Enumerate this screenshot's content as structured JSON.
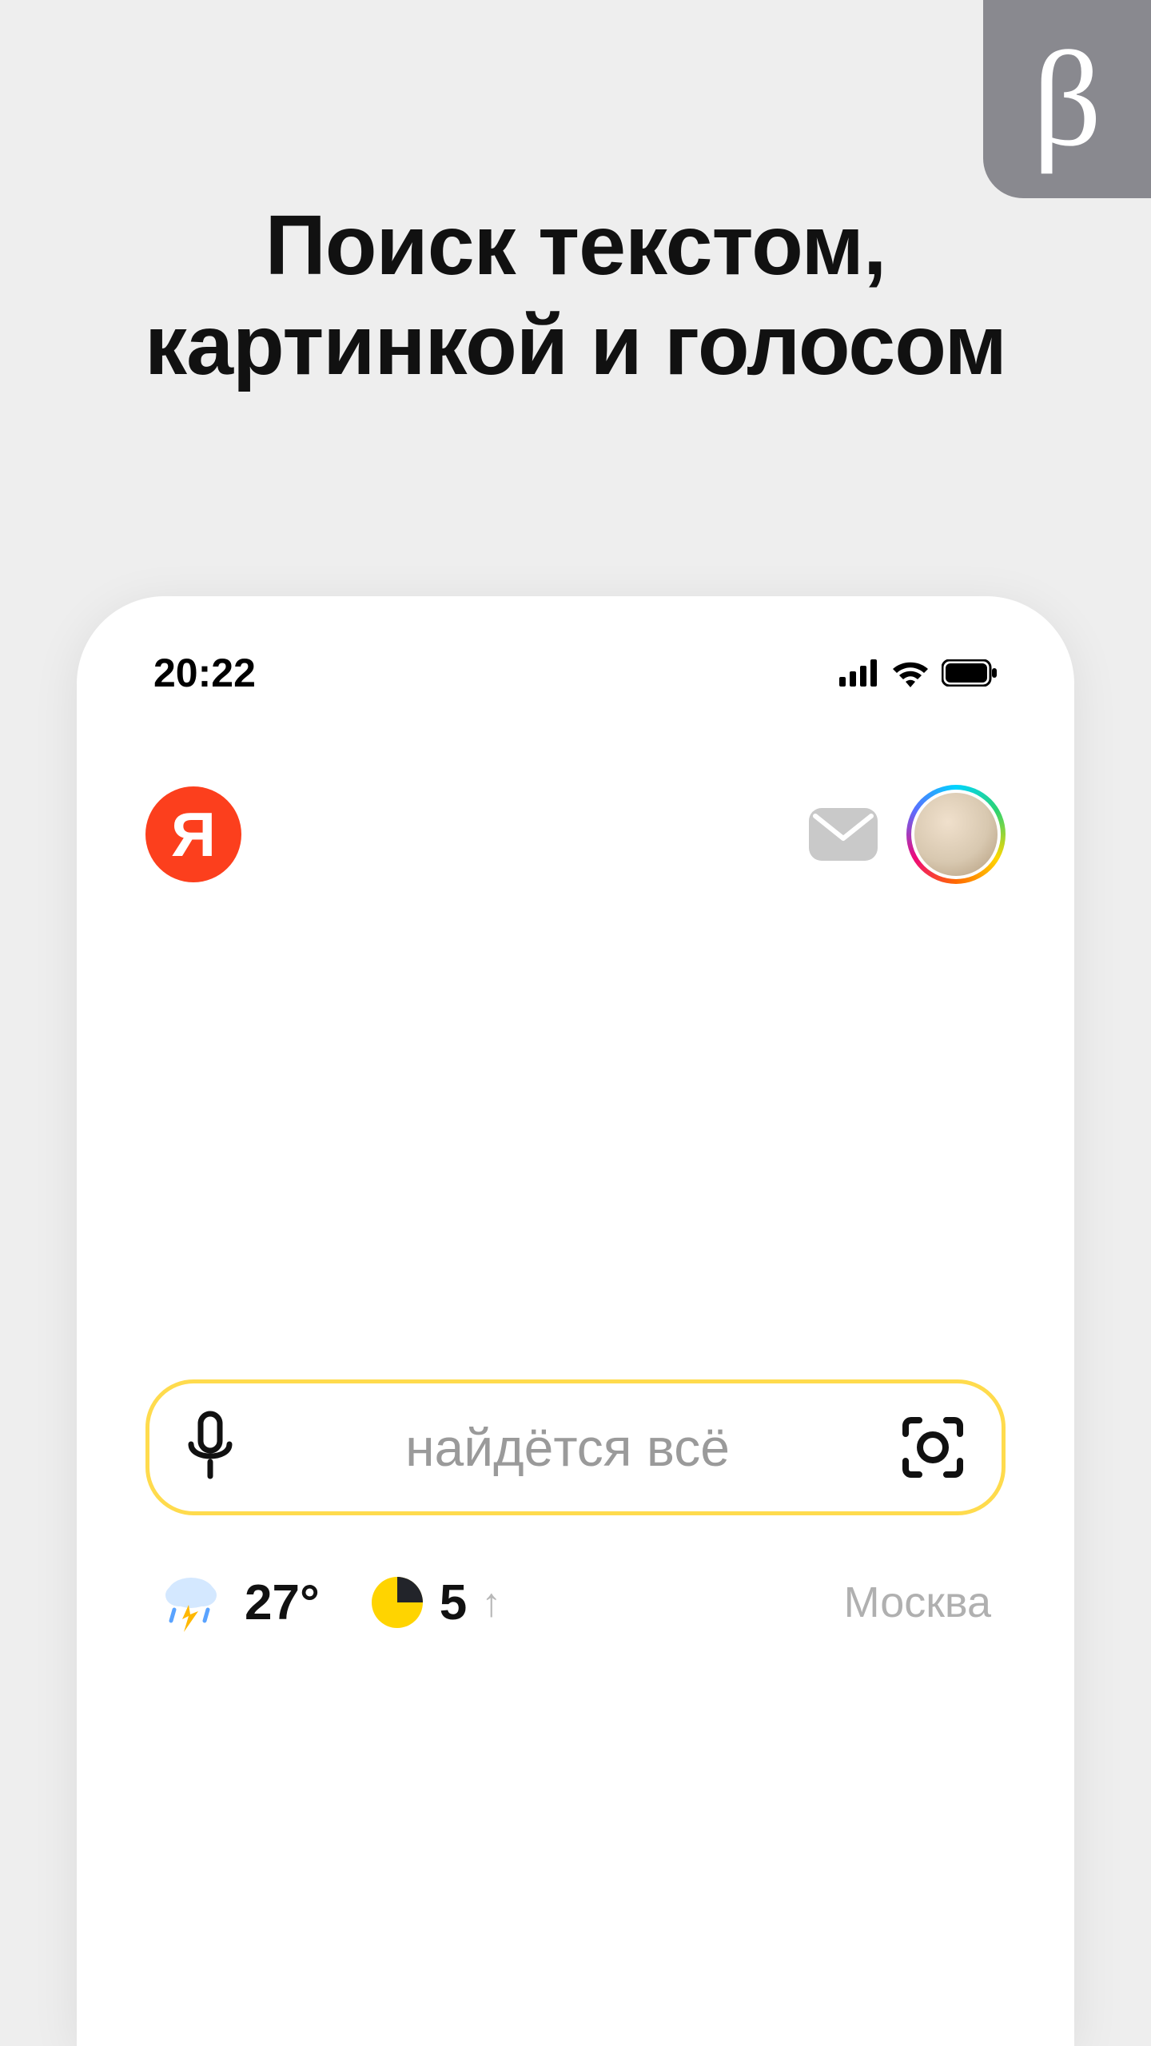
{
  "beta_badge": "β",
  "headline_line1": "Поиск текстом,",
  "headline_line2": "картинкой и голосом",
  "status": {
    "time": "20:22"
  },
  "app": {
    "logo_letter": "Я"
  },
  "search": {
    "placeholder": "найдётся всё"
  },
  "info": {
    "temperature": "27°",
    "stock_value": "5",
    "trend_arrow": "↑",
    "city": "Москва"
  }
}
